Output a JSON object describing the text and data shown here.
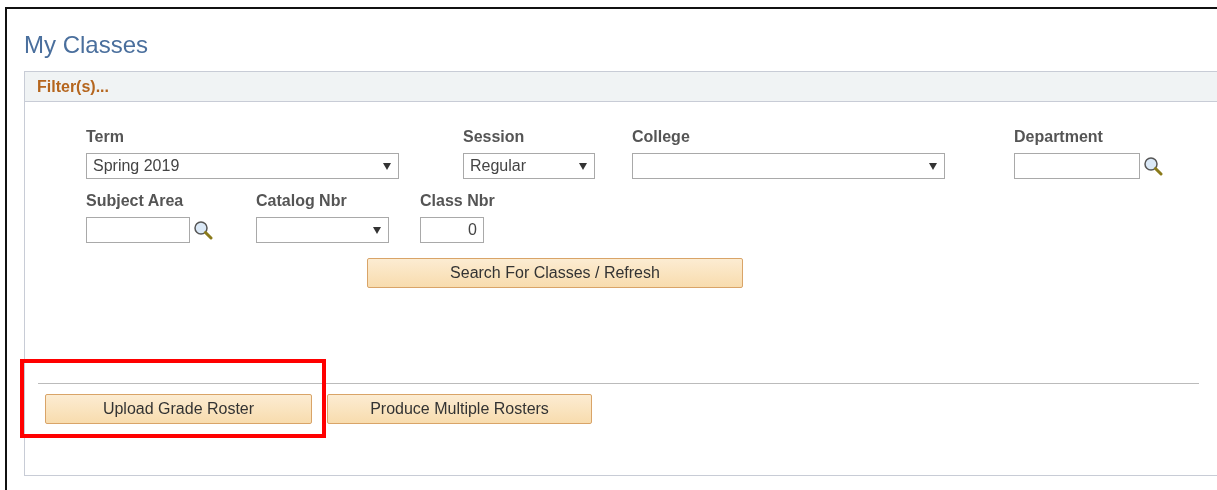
{
  "title": "My Classes",
  "filter_header": "Filter(s)...",
  "field_rows": [
    [
      {
        "kind": "select",
        "label": "Term",
        "value": "Spring 2019"
      },
      {
        "kind": "select",
        "label": "Session",
        "value": "Regular"
      },
      {
        "kind": "select",
        "label": "College"
      },
      {
        "kind": "lookup",
        "label": "Department"
      }
    ],
    [
      {
        "kind": "lookup",
        "label": "Subject Area"
      },
      {
        "kind": "select",
        "label": "Catalog Nbr"
      },
      {
        "kind": "number",
        "label": "Class Nbr",
        "value": "0"
      }
    ]
  ],
  "search_button": "Search For Classes / Refresh",
  "buttons": [
    {
      "label": "Upload Grade Roster",
      "highlighted": true
    },
    {
      "label": "Produce Multiple Rosters",
      "highlighted": false
    }
  ]
}
